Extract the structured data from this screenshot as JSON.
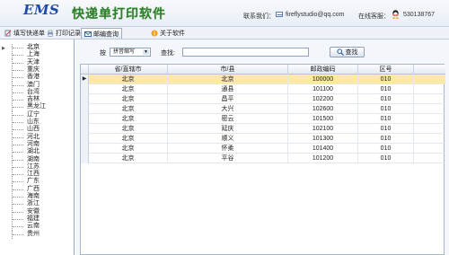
{
  "header": {
    "logo_text": "EMS",
    "app_title": "快递单打印软件",
    "contact_label": "联系我们：",
    "contact_email": "fireflystudio@qq.com",
    "online_label": "在线客服：",
    "qq_number": "530138767"
  },
  "toolbar": {
    "items": [
      {
        "label": "填写快递单",
        "icon": "edit-icon"
      },
      {
        "label": "打印记录",
        "icon": "print-icon"
      },
      {
        "label": "邮编查询",
        "icon": "mail-search-icon",
        "active": true
      },
      {
        "label": "关于软件",
        "icon": "info-icon"
      }
    ]
  },
  "tree": {
    "items": [
      "北京",
      "上海",
      "天津",
      "重庆",
      "香港",
      "澳门",
      "台湾",
      "吉林",
      "黑龙江",
      "辽宁",
      "山东",
      "山西",
      "河北",
      "河南",
      "湖北",
      "湖南",
      "江苏",
      "江西",
      "广东",
      "广西",
      "海南",
      "浙江",
      "安徽",
      "福建",
      "云南",
      "贵州"
    ],
    "selected_index": 0
  },
  "search": {
    "by_label": "按",
    "select_value": "拼音缩写",
    "label": "查找:",
    "input_value": "",
    "button_label": "查找"
  },
  "grid": {
    "columns": [
      "省/直辖市",
      "市/县",
      "邮政编码",
      "区号"
    ],
    "rows": [
      [
        "北京",
        "北京",
        "100000",
        "010"
      ],
      [
        "北京",
        "通县",
        "101100",
        "010"
      ],
      [
        "北京",
        "昌平",
        "102200",
        "010"
      ],
      [
        "北京",
        "大兴",
        "102600",
        "010"
      ],
      [
        "北京",
        "密云",
        "101500",
        "010"
      ],
      [
        "北京",
        "延庆",
        "102100",
        "010"
      ],
      [
        "北京",
        "顺义",
        "101300",
        "010"
      ],
      [
        "北京",
        "怀柔",
        "101400",
        "010"
      ],
      [
        "北京",
        "平谷",
        "101200",
        "010"
      ]
    ],
    "selected_row": 0
  },
  "colors": {
    "accent_blue": "#1f4aa8",
    "title_green": "#2e7d32",
    "selected_row": "#fde8a4"
  }
}
